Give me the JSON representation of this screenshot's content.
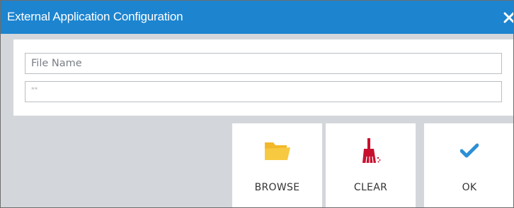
{
  "window": {
    "title": "External Application Configuration"
  },
  "form": {
    "file_name": {
      "value": "",
      "placeholder": "File Name"
    },
    "path": {
      "value": "\"\""
    }
  },
  "actions": {
    "browse": {
      "label": "BROWSE",
      "icon": "folder-icon",
      "color": "#f5c33b"
    },
    "clear": {
      "label": "CLEAR",
      "icon": "broom-icon",
      "color": "#c8102e"
    },
    "ok": {
      "label": "OK",
      "icon": "checkmark-icon",
      "color": "#2d8fd5"
    }
  },
  "colors": {
    "titlebar": "#1d84cf",
    "background": "#d3d7db"
  }
}
